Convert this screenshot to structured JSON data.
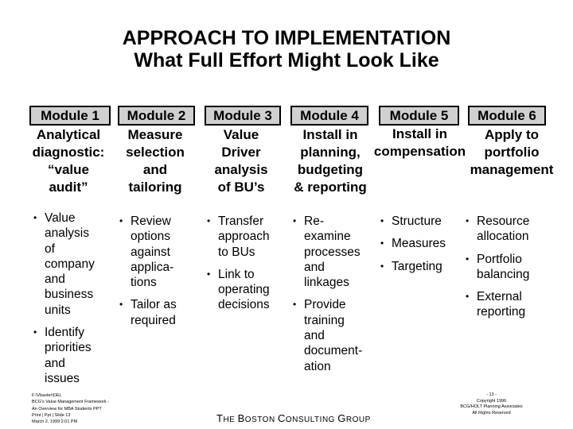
{
  "title": {
    "line1": "APPROACH TO IMPLEMENTATION",
    "line2": "What Full Effort Might Look Like"
  },
  "modules": [
    {
      "label": "Module 1",
      "description": "Analytical\ndiagnostic:\n“value\naudit”",
      "bullets": [
        "Value\nanalysis\nof\ncompany\nand\nbusiness\nunits",
        "Identify\npriorities\nand\nissues"
      ]
    },
    {
      "label": "Module 2",
      "description": "Measure\nselection\nand\ntailoring",
      "bullets": [
        "Review\noptions\nagainst\napplica-\ntions",
        "Tailor as\nrequired"
      ]
    },
    {
      "label": "Module 3",
      "description": "Value\nDriver\nanalysis\nof BU’s",
      "bullets": [
        "Transfer\napproach\nto BUs",
        "Link to\noperating\ndecisions"
      ]
    },
    {
      "label": "Module 4",
      "description": "Install in\nplanning,\nbudgeting\n& reporting",
      "bullets": [
        "Re-\nexamine\nprocesses\nand\nlinkages",
        "Provide\ntraining\nand\ndocument-\nation"
      ]
    },
    {
      "label": "Module 5",
      "description": "Install in\ncompensation",
      "bullets": [
        "Structure",
        "Measures",
        "Targeting"
      ]
    },
    {
      "label": "Module 6",
      "description": "Apply to\nportfolio\nmanagement",
      "bullets": [
        "Resource\nallocation",
        "Portfolio\nbalancing",
        "External\nreporting"
      ]
    }
  ],
  "bullet_glyph": "•",
  "footer": {
    "left": "F:\\Vbaxter\\DEL\nBCG's Value Management Framework -\nAn Overview for MBA Students PPT\nPrint | Ppt | Slide 13\nMarch 2, 1999 2:01 PM",
    "center": {
      "parts": [
        {
          "cap": "T",
          "rest": "HE "
        },
        {
          "cap": "B",
          "rest": "OSTON "
        },
        {
          "cap": "C",
          "rest": "ONSULTING "
        },
        {
          "cap": "G",
          "rest": "ROUP"
        }
      ]
    },
    "right": "- 13 -\nCopyright 1996\nBCG/HOLT Planning Associates\nAll Rights Reserved"
  },
  "colors": {
    "module_box_fill": "#d0d0d0",
    "module_box_border": "#000000",
    "text": "#000000",
    "background": "#ffffff"
  }
}
